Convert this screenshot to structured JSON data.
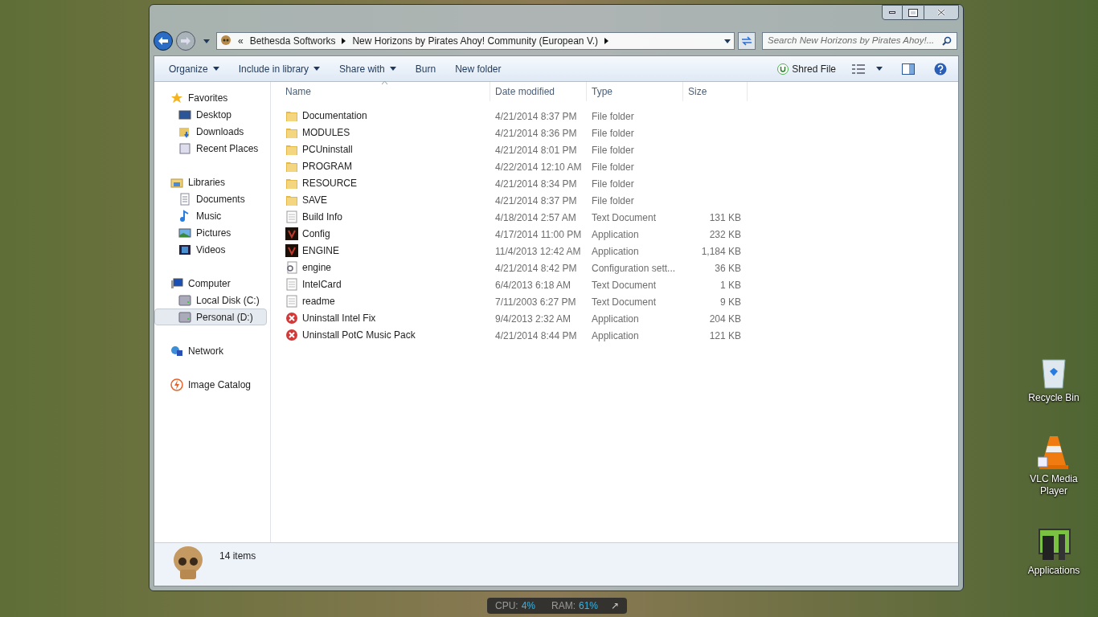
{
  "address_bar": {
    "breadcrumbs": [
      "«",
      "Bethesda Softworks",
      "New Horizons by Pirates Ahoy! Community (European V.)"
    ]
  },
  "search": {
    "placeholder": "Search New Horizons by Pirates Ahoy!..."
  },
  "toolbar": {
    "items": [
      {
        "label": "Organize",
        "dropdown": true
      },
      {
        "label": "Include in library",
        "dropdown": true
      },
      {
        "label": "Share with",
        "dropdown": true
      },
      {
        "label": "Burn",
        "dropdown": false
      },
      {
        "label": "New folder",
        "dropdown": false
      }
    ],
    "shred": "Shred File"
  },
  "sidebar": {
    "groups": [
      {
        "label": "Favorites",
        "kind": "star",
        "selected": false,
        "children": [
          {
            "label": "Desktop",
            "kind": "desktop",
            "selected": false
          },
          {
            "label": "Downloads",
            "kind": "downloads",
            "selected": false
          },
          {
            "label": "Recent Places",
            "kind": "recent",
            "selected": false
          }
        ]
      },
      {
        "label": "Libraries",
        "kind": "library",
        "selected": false,
        "children": [
          {
            "label": "Documents",
            "kind": "document",
            "selected": false
          },
          {
            "label": "Music",
            "kind": "music",
            "selected": false
          },
          {
            "label": "Pictures",
            "kind": "picture",
            "selected": false
          },
          {
            "label": "Videos",
            "kind": "video",
            "selected": false
          }
        ]
      },
      {
        "label": "Computer",
        "kind": "computer",
        "selected": false,
        "children": [
          {
            "label": "Local Disk (C:)",
            "kind": "disk",
            "selected": false
          },
          {
            "label": "Personal (D:)",
            "kind": "disk",
            "selected": true
          }
        ]
      },
      {
        "label": "Network",
        "kind": "network",
        "selected": false
      },
      {
        "label": "Image Catalog",
        "kind": "catalog",
        "selected": false
      }
    ]
  },
  "table": {
    "columns": [
      "Name",
      "Date modified",
      "Type",
      "Size"
    ],
    "rows": [
      {
        "name": "Documentation",
        "date": "4/21/2014 8:37 PM",
        "type": "File folder",
        "kind": "folder"
      },
      {
        "name": "MODULES",
        "date": "4/21/2014 8:36 PM",
        "type": "File folder",
        "kind": "folder"
      },
      {
        "name": "PCUninstall",
        "date": "4/21/2014 8:01 PM",
        "type": "File folder",
        "kind": "folder"
      },
      {
        "name": "PROGRAM",
        "date": "4/22/2014 12:10 AM",
        "type": "File folder",
        "kind": "folder"
      },
      {
        "name": "RESOURCE",
        "date": "4/21/2014 8:34 PM",
        "type": "File folder",
        "kind": "folder"
      },
      {
        "name": "SAVE",
        "date": "4/21/2014 8:37 PM",
        "type": "File folder",
        "kind": "folder"
      },
      {
        "name": "Build Info",
        "date": "4/18/2014 2:57 AM",
        "type": "Text Document",
        "size": "131 KB",
        "kind": "text"
      },
      {
        "name": "Config",
        "date": "4/17/2014 11:00 PM",
        "type": "Application",
        "size": "232 KB",
        "kind": "game"
      },
      {
        "name": "ENGINE",
        "date": "11/4/2013 12:42 AM",
        "type": "Application",
        "size": "1,184 KB",
        "kind": "game"
      },
      {
        "name": "engine",
        "date": "4/21/2014 8:42 PM",
        "type": "Configuration sett...",
        "size": "36 KB",
        "kind": "config"
      },
      {
        "name": "IntelCard",
        "date": "6/4/2013 6:18 AM",
        "type": "Text Document",
        "size": "1 KB",
        "kind": "text"
      },
      {
        "name": "readme",
        "date": "7/11/2003 6:27 PM",
        "type": "Text Document",
        "size": "9 KB",
        "kind": "text"
      },
      {
        "name": "Uninstall Intel Fix",
        "date": "9/4/2013 2:32 AM",
        "type": "Application",
        "size": "204 KB",
        "kind": "uninstall"
      },
      {
        "name": "Uninstall PotC Music Pack",
        "date": "4/21/2014 8:44 PM",
        "type": "Application",
        "size": "121 KB",
        "kind": "uninstall"
      }
    ]
  },
  "details_pane": {
    "count": "14 items"
  },
  "desktop_icons": [
    {
      "label": "Recycle Bin",
      "kind": "recycle"
    },
    {
      "label": "VLC Media Player",
      "kind": "cone"
    },
    {
      "label": "Applications",
      "kind": "apps"
    }
  ],
  "system_monitor": {
    "cpu_label": "CPU:",
    "cpu": "4%",
    "ram_label": "RAM:",
    "ram": "61%",
    "expand": "↗"
  }
}
